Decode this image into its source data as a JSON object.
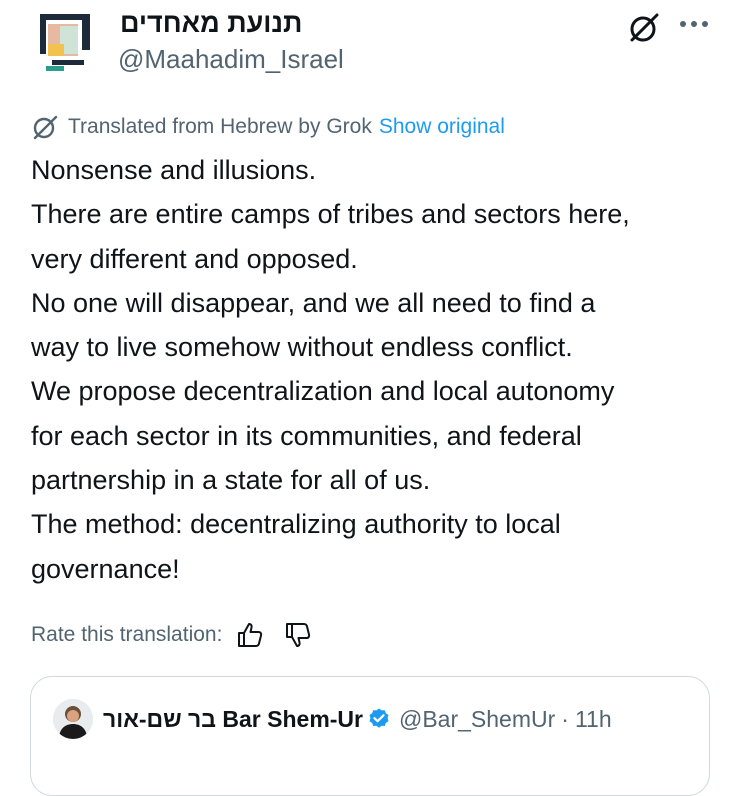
{
  "post": {
    "author": {
      "display_name": "תנועת מאחדים",
      "handle": "@Maahadim_Israel"
    },
    "header_icons": {
      "grok": "grok-icon",
      "more": "more-dots-icon"
    },
    "translation": {
      "label": "Translated from Hebrew by Grok",
      "show_original": "Show original",
      "icon": "grok-translate-icon"
    },
    "body_lines": [
      "Nonsense and illusions.",
      "There are entire camps of tribes and sectors here,",
      "very different and opposed.",
      "No one will disappear, and we all need to find a",
      "way to live somehow without endless conflict.",
      "We propose decentralization and local autonomy",
      "for each sector in its communities, and federal",
      "partnership in a state for all of us.",
      "The method: decentralizing authority to local",
      "governance!"
    ],
    "rate": {
      "label": "Rate this translation:",
      "thumbs_up_icon": "thumbs-up-icon",
      "thumbs_down_icon": "thumbs-down-icon"
    }
  },
  "quoted_post": {
    "display_name": "בר שם-אור Bar Shem-Ur",
    "handle": "@Bar_ShemUr",
    "separator": "·",
    "time": "11h",
    "verified": true
  },
  "colors": {
    "text": "#0f1419",
    "secondary": "#536471",
    "link": "#1d9bf0",
    "border": "#cfd9de",
    "verified": "#1d9bf0"
  }
}
